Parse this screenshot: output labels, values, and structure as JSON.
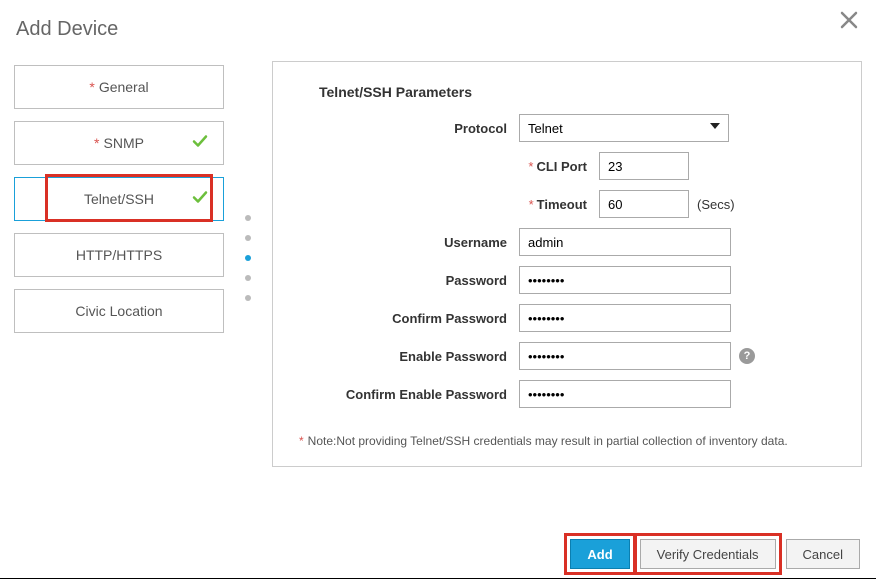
{
  "dialog": {
    "title": "Add Device"
  },
  "nav": {
    "general": "General",
    "snmp": "SNMP",
    "telnet": "Telnet/SSH",
    "http": "HTTP/HTTPS",
    "civic": "Civic Location"
  },
  "panel": {
    "heading": "Telnet/SSH Parameters",
    "labels": {
      "protocol": "Protocol",
      "cliport": "CLI Port",
      "timeout": "Timeout",
      "username": "Username",
      "password": "Password",
      "confirm_password": "Confirm Password",
      "enable_password": "Enable Password",
      "confirm_enable_password": "Confirm Enable Password"
    },
    "values": {
      "protocol": "Telnet",
      "cliport": "23",
      "timeout": "60",
      "username": "admin",
      "password": "••••••••",
      "confirm_password": "••••••••",
      "enable_password": "••••••••",
      "confirm_enable_password": "••••••••"
    },
    "timeout_suffix": "(Secs)",
    "note_prefix": "*",
    "note_text": "Note:Not providing Telnet/SSH credentials may result in partial collection of inventory data."
  },
  "buttons": {
    "add": "Add",
    "verify": "Verify Credentials",
    "cancel": "Cancel"
  },
  "icons": {
    "help": "?"
  }
}
